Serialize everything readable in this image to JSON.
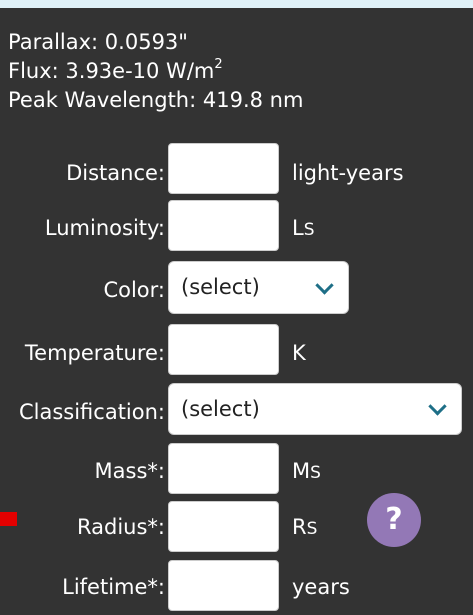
{
  "info": {
    "parallax": "Parallax: 0.0593\"",
    "flux_text": "Flux: 3.93e-10 W/m",
    "flux_exponent": "2",
    "peak_wavelength": "Peak Wavelength: 419.8 nm"
  },
  "form": {
    "distance": {
      "label": "Distance:",
      "value": "",
      "unit": "light-years"
    },
    "luminosity": {
      "label": "Luminosity:",
      "value": "",
      "unit_main": "L",
      "unit_sub": "S"
    },
    "color": {
      "label": "Color:",
      "selected": "(select)"
    },
    "temperature": {
      "label": "Temperature:",
      "value": "",
      "unit": "K"
    },
    "classification": {
      "label": "Classification:",
      "selected": "(select)"
    },
    "mass": {
      "label": "Mass*:",
      "value": "",
      "unit_main": "M",
      "unit_sub": "S"
    },
    "radius": {
      "label": "Radius*:",
      "value": "",
      "unit_main": "R",
      "unit_sub": "S"
    },
    "lifetime": {
      "label": "Lifetime*:",
      "value": "",
      "unit": "years"
    }
  },
  "help": {
    "symbol": "?"
  },
  "colors": {
    "background": "#333333",
    "top_strip": "#dff1f8",
    "help_button": "#9378b6",
    "chevron": "#1e6f87",
    "marker": "#e30000"
  },
  "icons": {
    "help": "question-icon",
    "dropdown": "chevron-down-icon"
  }
}
